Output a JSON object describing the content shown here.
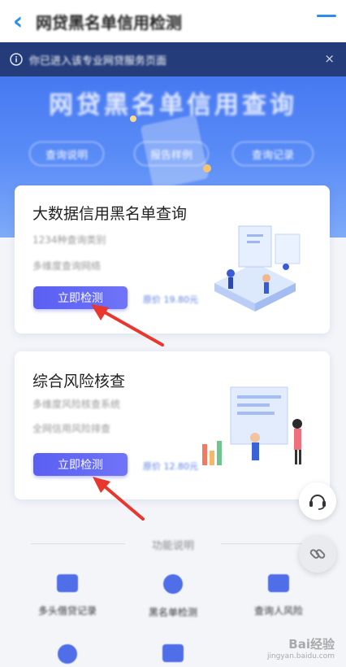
{
  "header": {
    "back_icon": "chevron-left-icon",
    "title": "网贷黑名单信用检测",
    "menu_icon": "menu-icon"
  },
  "hero": {
    "notice": "你已进入该专业网贷服务页面",
    "notice_close": "×",
    "title": "网贷黑名单信用查询",
    "pills": [
      "查询说明",
      "报告样例",
      "查询记录"
    ]
  },
  "cards": [
    {
      "title": "大数据信用黑名单查询",
      "sub1": "1234种查询类别",
      "sub2": "多维度查询网络",
      "button": "立即检测",
      "price": "原价 19.80元"
    },
    {
      "title": "综合风险核查",
      "sub1": "多维度风险核查系统",
      "sub2": "全网信用风险排查",
      "button": "立即检测",
      "price": "原价 12.80元"
    }
  ],
  "section": {
    "title": "功能说明"
  },
  "functions": [
    {
      "label": "多头借贷记录",
      "icon": "id-card-icon"
    },
    {
      "label": "黑名单检测",
      "icon": "circle-check-icon"
    },
    {
      "label": "查询人风险",
      "icon": "user-scan-icon"
    }
  ],
  "float_buttons": {
    "service_icon": "headset-icon",
    "share_icon": "link-icon"
  },
  "watermark": {
    "brand": "Bai经验",
    "url": "jingyan.baidu.com"
  },
  "colors": {
    "accent": "#2f8cf0",
    "button": "#5a5ff2",
    "hero": "#4a7df3",
    "arrow": "#e8372d"
  }
}
